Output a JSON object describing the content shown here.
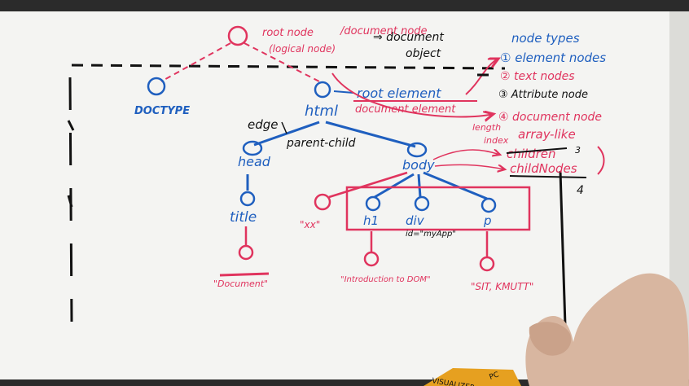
{
  "colors": {
    "board": "#f4f4f2",
    "blue": "#1f5fbf",
    "red": "#e0345e",
    "black": "#111111",
    "skin": "#d8b6a0"
  },
  "top": {
    "root_node": "root node",
    "document_node": "/document node",
    "arrow": "⇒ document",
    "object": "object",
    "logical_node": "(logical node)"
  },
  "node_types": {
    "title": "node types",
    "items": [
      "① element nodes",
      "② text nodes",
      "③ Attribute node",
      "④ document node"
    ]
  },
  "tree": {
    "doctype": "DOCTYPE",
    "html": "html",
    "edge": "edge",
    "parent_child": "parent-child",
    "root_element": "root element",
    "document_element": "document element",
    "head": "head",
    "body": "body",
    "title": "title",
    "text_xx": "\"xx\"",
    "h1": "h1",
    "div": "div",
    "p": "p",
    "id_attr": "id=\"myApp\"",
    "title_text": "\"Document\"",
    "h1_text": "\"Introduction to DOM\"",
    "p_text": "\"SIT, KMUTT\""
  },
  "array_note": {
    "length": "length",
    "index": "index",
    "array_like": "array-like",
    "children": "children",
    "children_count": "3",
    "child_nodes": "childNodes",
    "child_nodes_count": "4"
  },
  "watermark": {
    "corner_1": "VISUALIZER",
    "corner_2": "PC"
  }
}
